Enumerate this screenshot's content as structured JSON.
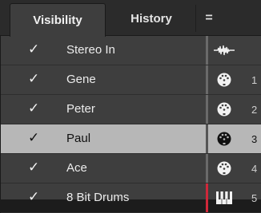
{
  "tabs": [
    {
      "label": "Visibility"
    },
    {
      "label": "History"
    },
    {
      "label": "="
    }
  ],
  "tracks": [
    {
      "name": "Stereo In",
      "check": "✓",
      "icon": "audio-waveform-icon",
      "number": ""
    },
    {
      "name": "Gene",
      "check": "✓",
      "icon": "midi-port-icon",
      "number": "1"
    },
    {
      "name": "Peter",
      "check": "✓",
      "icon": "midi-port-icon",
      "number": "2"
    },
    {
      "name": "Paul",
      "check": "✓",
      "icon": "midi-port-icon",
      "number": "3"
    },
    {
      "name": "Ace",
      "check": "✓",
      "icon": "midi-port-icon",
      "number": "4"
    },
    {
      "name": "8 Bit Drums",
      "check": "✓",
      "icon": "instrument-keyboard-icon",
      "number": "5"
    }
  ],
  "colors": {
    "selected_row": "#b7b7b7",
    "accent_red": "#d0283a"
  }
}
